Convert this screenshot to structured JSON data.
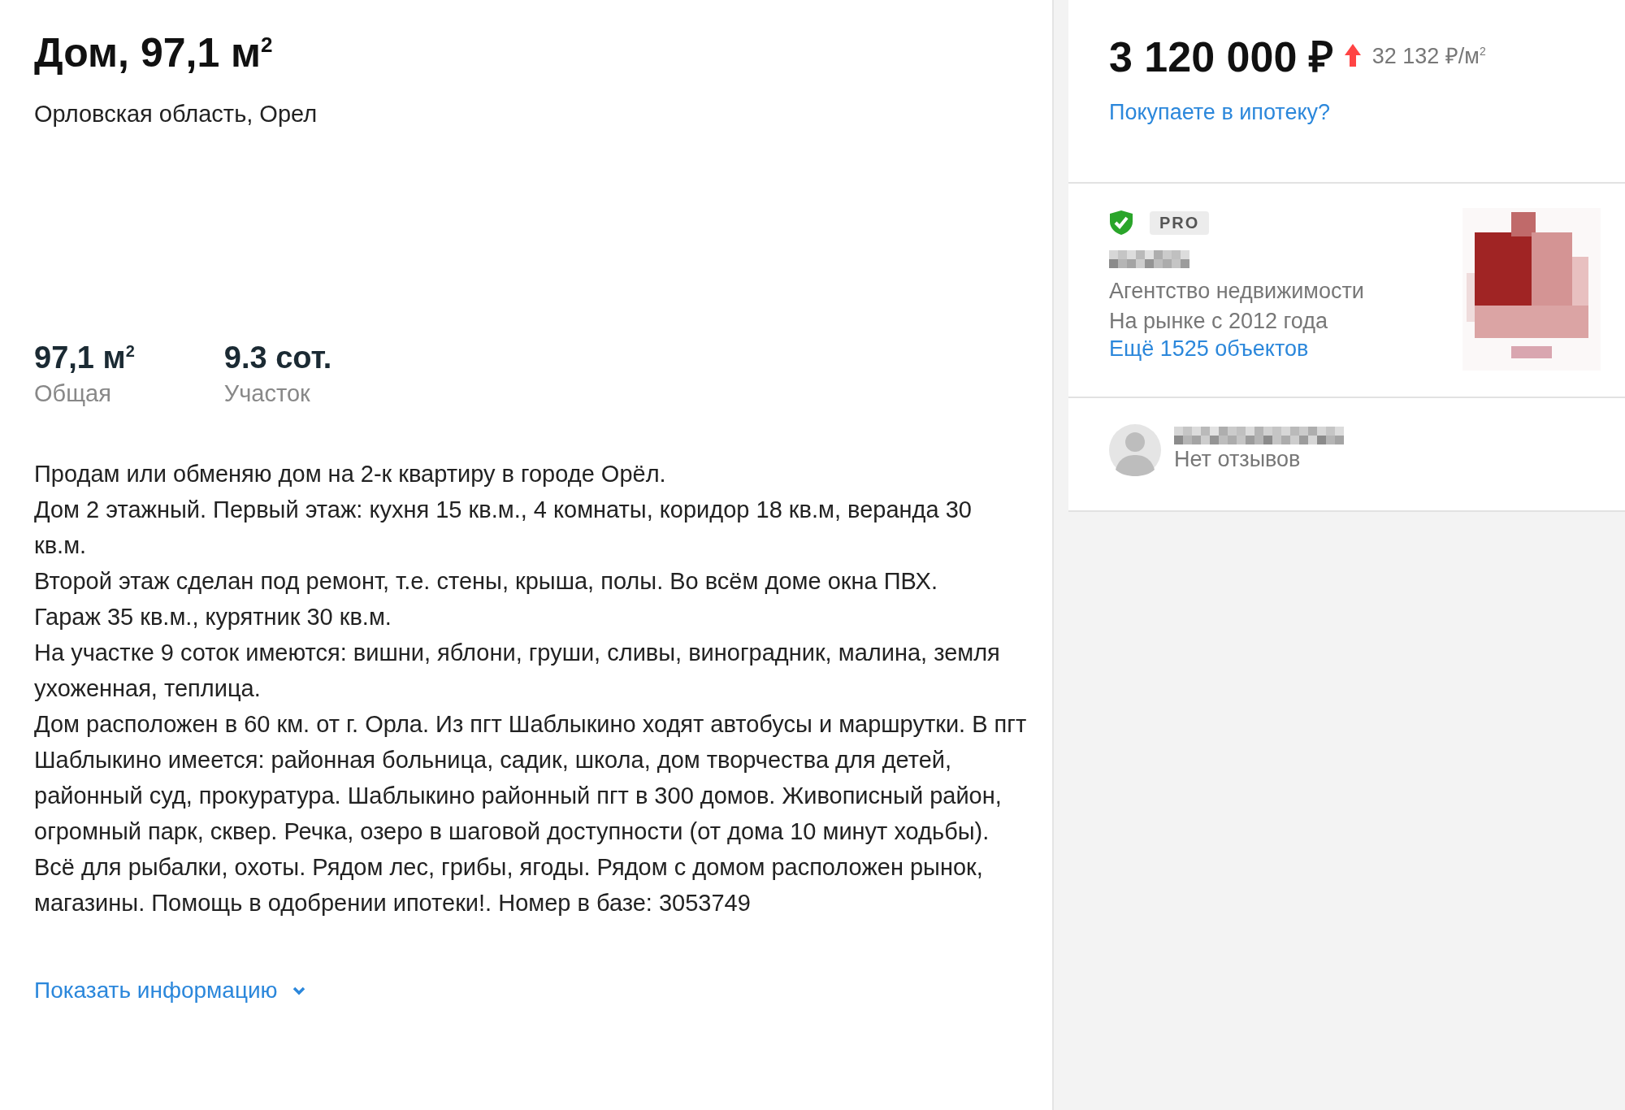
{
  "listing": {
    "title": "Дом, 97,1 м$^{2}$",
    "address": "Орловская область, Орел",
    "stats": [
      {
        "value": "97,1 м$^{2}$",
        "label": "Общая"
      },
      {
        "value": "9.3 сот.",
        "label": "Участок"
      }
    ],
    "description": [
      "Продам или обменяю дом на 2-к квартиру в городе Орёл.",
      "Дом 2 этажный. Первый этаж: кухня 15 кв.м., 4 комнаты, коридор 18 кв.м, веранда 30 кв.м.",
      "Второй этаж сделан под ремонт, т.е. стены, крыша, полы. Во всём доме окна ПВХ.",
      "Гараж 35 кв.м., курятник 30 кв.м.",
      "На участке 9 соток имеются: вишни, яблони, груши, сливы, виноградник, малина, земля ухоженная, теплица.",
      "Дом расположен в 60 км. от г. Орла. Из пгт Шаблыкино ходят автобусы и маршрутки. В пгт Шаблыкино имеется: районная больница, садик, школа, дом творчества для детей, районный суд, прокуратура. Шаблыкино районный пгт в 300 домов. Живописный район, огромный парк, сквер. Речка, озеро в шаговой доступности (от дома 10 минут ходьбы). Всё для рыбалки, охоты. Рядом лес, грибы, ягоды. Рядом с домом расположен рынок, магазины. Помощь в одобрении ипотеки!. Номер в базе: 3053749"
    ],
    "show_more": "Показать информацию"
  },
  "price": {
    "amount": "3 120 000 ₽",
    "rising": true,
    "per_meter": "32 132 ₽/м$^{2}$",
    "mortgage_link": "Покупаете в ипотеку?"
  },
  "agent": {
    "verified": true,
    "badge": "PRO",
    "type": "Агентство недвижимости",
    "since": "На рынке с 2012 года",
    "more_link": "Ещё 1525 объектов"
  },
  "reviews": {
    "text": "Нет отзывов"
  }
}
